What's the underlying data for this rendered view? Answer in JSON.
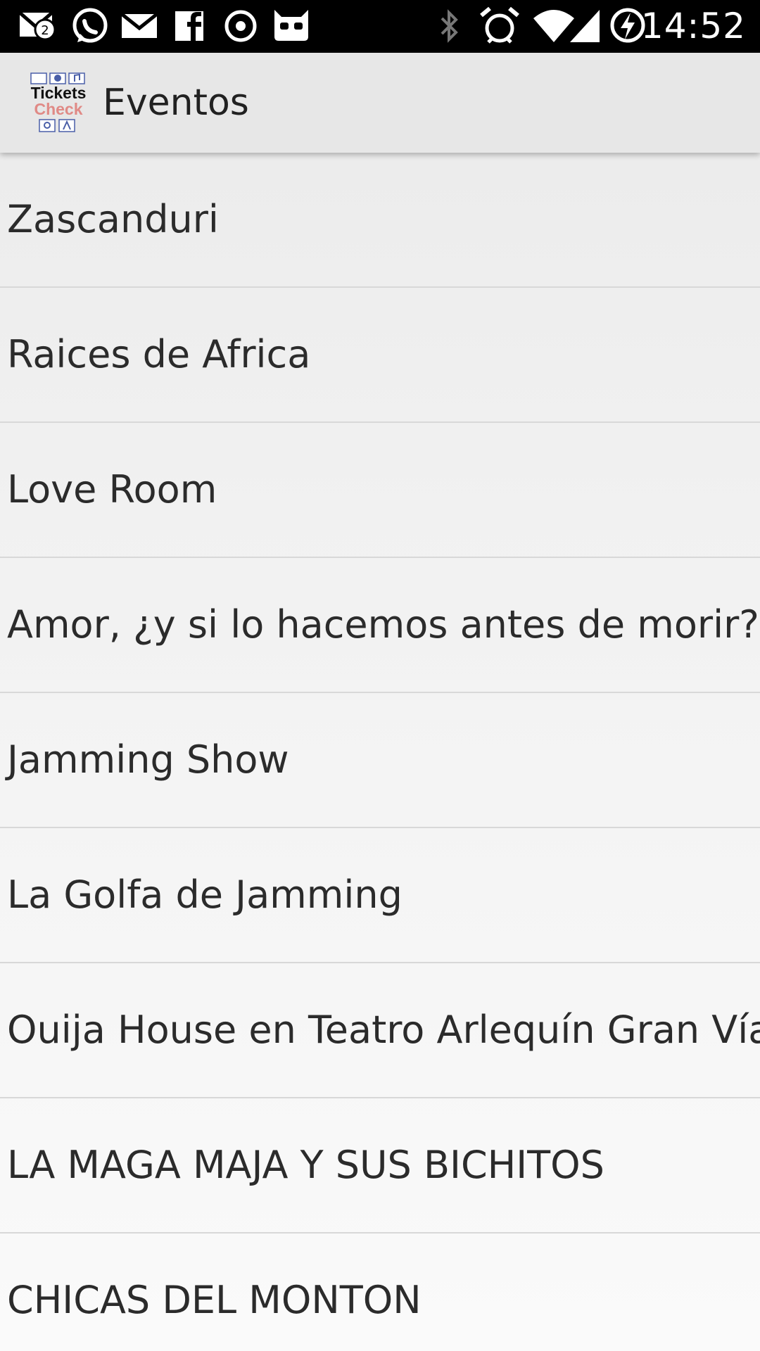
{
  "status_bar": {
    "notification_badge": "2",
    "time": "14:52",
    "left_icons": [
      "gmail-icon",
      "whatsapp-icon",
      "email-icon",
      "facebook-icon",
      "circle-app-icon",
      "cyanogen-icon"
    ],
    "right_icons": [
      "bluetooth-icon",
      "alarm-icon",
      "wifi-icon",
      "cell-signal-icon",
      "battery-charging-icon"
    ]
  },
  "app_bar": {
    "logo_text_top": "Tickets",
    "logo_text_bottom": "Check",
    "title": "Eventos"
  },
  "events": [
    {
      "label": "Zascanduri"
    },
    {
      "label": "Raices de Africa"
    },
    {
      "label": "Love Room"
    },
    {
      "label": "Amor, ¿y si lo hacemos antes de morir?"
    },
    {
      "label": "Jamming Show"
    },
    {
      "label": "La Golfa de Jamming"
    },
    {
      "label": "Ouija House en Teatro Arlequín Gran Vía"
    },
    {
      "label": "LA MAGA MAJA Y SUS BICHITOS"
    },
    {
      "label": "CHICAS DEL MONTON"
    }
  ],
  "colors": {
    "status_bar_bg": "#000000",
    "app_bar_bg": "#e7e7e7",
    "text": "#2b2b2b",
    "logo_check": "#e08a86",
    "logo_icons": "#4a5fa8"
  }
}
